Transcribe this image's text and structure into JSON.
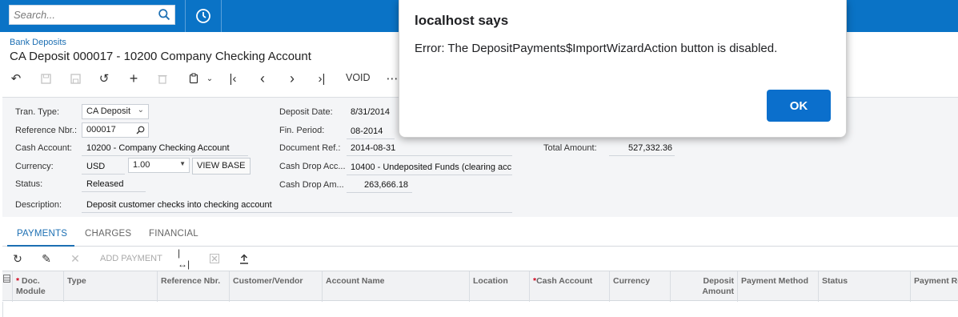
{
  "topbar": {
    "search_placeholder": "Search...",
    "icons": [
      "search-icon",
      "history-icon"
    ]
  },
  "header": {
    "breadcrumb": "Bank Deposits",
    "title": "CA Deposit 000017 - 10200 Company Checking Account"
  },
  "toolbar": {
    "void_label": "VOID",
    "more_label": "⋯"
  },
  "form": {
    "tran_type_label": "Tran. Type:",
    "tran_type_value": "CA Deposit",
    "reference_label": "Reference Nbr.:",
    "reference_value": "000017",
    "cash_account_label": "Cash Account:",
    "cash_account_value": "10200 - Company Checking Account",
    "currency_label": "Currency:",
    "currency_value": "USD",
    "rate_value": "1.00",
    "view_base_label": "VIEW BASE",
    "status_label": "Status:",
    "status_value": "Released",
    "description_label": "Description:",
    "description_value": "Deposit customer checks into checking account",
    "deposit_date_label": "Deposit Date:",
    "deposit_date_value": "8/31/2014",
    "fin_period_label": "Fin. Period:",
    "fin_period_value": "08-2014",
    "document_ref_label": "Document Ref.:",
    "document_ref_value": "2014-08-31",
    "cash_drop_acc_label": "Cash Drop Acc...",
    "cash_drop_acc_value": "10400 - Undeposited Funds (clearing acc",
    "cash_drop_amt_label": "Cash Drop Am...",
    "cash_drop_amt_value": "263,666.18",
    "total_amount_label": "Total Amount:",
    "total_amount_value": "527,332.36"
  },
  "tabs": [
    {
      "label": "PAYMENTS",
      "active": true
    },
    {
      "label": "CHARGES",
      "active": false
    },
    {
      "label": "FINANCIAL",
      "active": false
    }
  ],
  "grid_toolbar": {
    "add_payment_label": "ADD PAYMENT"
  },
  "grid": {
    "columns": [
      {
        "label": "Doc. Module",
        "required": true
      },
      {
        "label": "Type",
        "required": false
      },
      {
        "label": "Reference Nbr.",
        "required": false
      },
      {
        "label": "Customer/Vendor",
        "required": false
      },
      {
        "label": "Account Name",
        "required": false
      },
      {
        "label": "Location",
        "required": false
      },
      {
        "label": "Cash Account",
        "required": true
      },
      {
        "label": "Currency",
        "required": false
      },
      {
        "label": "Deposit Amount",
        "required": false
      },
      {
        "label": "Payment Method",
        "required": false
      },
      {
        "label": "Status",
        "required": false
      },
      {
        "label": "Payment Re",
        "required": false
      }
    ]
  },
  "dialog": {
    "title": "localhost says",
    "message": "Error: The DepositPayments$ImportWizardAction button is disabled.",
    "ok_label": "OK"
  },
  "colors": {
    "topbar": "#0a73c6",
    "accent": "#1c6fb3",
    "ok_button": "#0b6fcc"
  }
}
